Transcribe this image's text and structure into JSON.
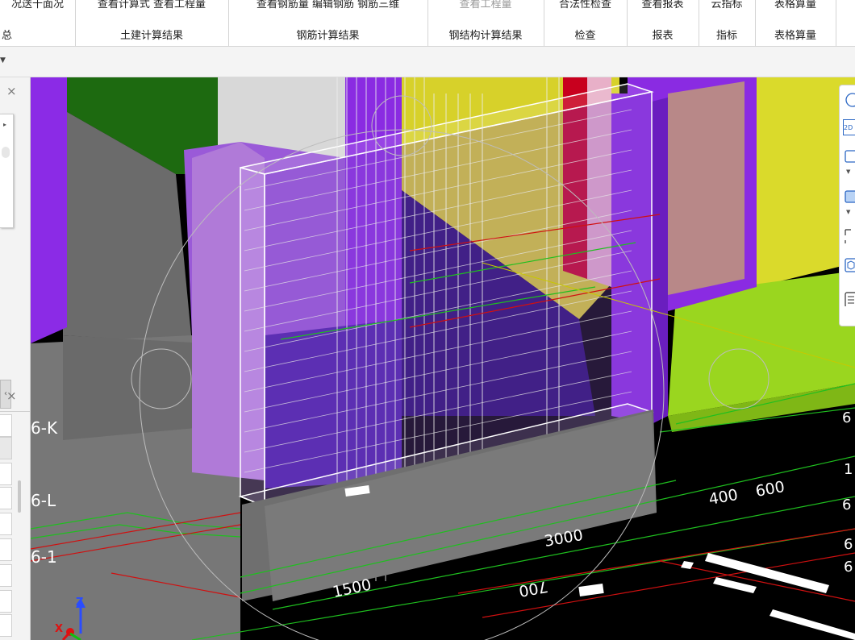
{
  "ribbon": {
    "groups": [
      {
        "top": "况送十面况",
        "label": "总"
      },
      {
        "top": "查看计算式 查看工程量",
        "label": "土建计算结果"
      },
      {
        "top": "查看钢筋量 编辑钢筋 钢筋三维",
        "label": "钢筋计算结果"
      },
      {
        "top": "查看工程量",
        "label": "钢结构计算结果"
      },
      {
        "top": "合法性检查",
        "label": "检查"
      },
      {
        "top": "查看报表",
        "label": "报表"
      },
      {
        "top": "云指标",
        "label": "指标"
      },
      {
        "top": "表格算量",
        "label": "表格算量"
      }
    ]
  },
  "left_panel": {
    "close_glyph": "×",
    "collapse_glyph": "‹"
  },
  "viewport": {
    "grid_labels_left": [
      "6-K",
      "6-L",
      "6-1"
    ],
    "grid_labels_right": [
      "6",
      "1",
      "6",
      "6",
      "6"
    ],
    "dimensions": [
      "400",
      "600",
      "3000",
      "1500",
      "700"
    ],
    "axis": {
      "z": "Z",
      "x": "X"
    },
    "colors": {
      "background": "#000000",
      "purple_wall": "#8a2be2",
      "light_purple": "#b07ad8",
      "yellow": "#d8d22a",
      "green": "#1f6b0c",
      "lime": "#9ad61f",
      "grey": "#6e6e6e",
      "red_col": "#c8001e",
      "dim_green": "#1fbf1f",
      "dim_red": "#d01010"
    }
  },
  "right_toolbar": {
    "icons": [
      "orbit-icon",
      "view-2d-icon",
      "cube-icon",
      "cube-solid-icon",
      "box-select-icon",
      "cube-3d-icon",
      "list-icon"
    ],
    "labels": [
      "2D"
    ]
  }
}
